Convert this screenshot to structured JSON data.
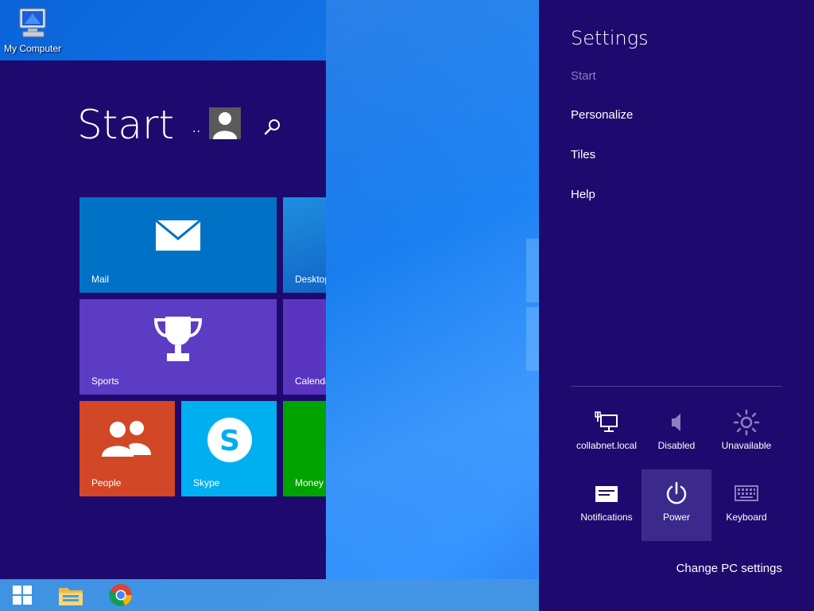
{
  "desktop": {
    "icons": [
      {
        "label": "My Computer",
        "icon": "computer-icon"
      }
    ]
  },
  "start_screen": {
    "title": "Start",
    "user_dots": "..",
    "user_avatar": "user-avatar-icon",
    "search_icon": "search-icon",
    "tiles": [
      {
        "label": "Mail",
        "icon": "mail-icon",
        "color": "#0072c6"
      },
      {
        "label": "Desktop",
        "icon": "",
        "color": "#1a8ad4"
      },
      {
        "label": "Sports",
        "icon": "trophy-icon",
        "color": "#5d3cc4"
      },
      {
        "label": "Calendar",
        "icon": "",
        "color": "#5a35c0"
      },
      {
        "label": "People",
        "icon": "people-icon",
        "color": "#d24726"
      },
      {
        "label": "Skype",
        "icon": "skype-icon",
        "color": "#00aff0"
      },
      {
        "label": "Money",
        "icon": "",
        "color": "#00a300"
      }
    ]
  },
  "taskbar": {
    "items": [
      {
        "name": "start-button",
        "icon": "windows-logo-icon"
      },
      {
        "name": "file-explorer",
        "icon": "folder-icon"
      },
      {
        "name": "chrome",
        "icon": "chrome-icon"
      }
    ]
  },
  "settings_charm": {
    "title": "Settings",
    "links": [
      {
        "label": "Start",
        "dimmed": true
      },
      {
        "label": "Personalize",
        "dimmed": false
      },
      {
        "label": "Tiles",
        "dimmed": false
      },
      {
        "label": "Help",
        "dimmed": false
      }
    ],
    "quick_settings": [
      {
        "label": "collabnet.local",
        "icon": "network-icon"
      },
      {
        "label": "Disabled",
        "icon": "volume-icon"
      },
      {
        "label": "Unavailable",
        "icon": "brightness-icon"
      },
      {
        "label": "Notifications",
        "icon": "notifications-icon"
      },
      {
        "label": "Power",
        "icon": "power-icon",
        "active": true
      },
      {
        "label": "Keyboard",
        "icon": "keyboard-icon"
      }
    ],
    "change_pc_settings": "Change PC settings"
  },
  "colors": {
    "start_bg": "#1e0a6e",
    "charm_bg": "#1e0a6e",
    "accent_active": "#3b2a8c"
  }
}
